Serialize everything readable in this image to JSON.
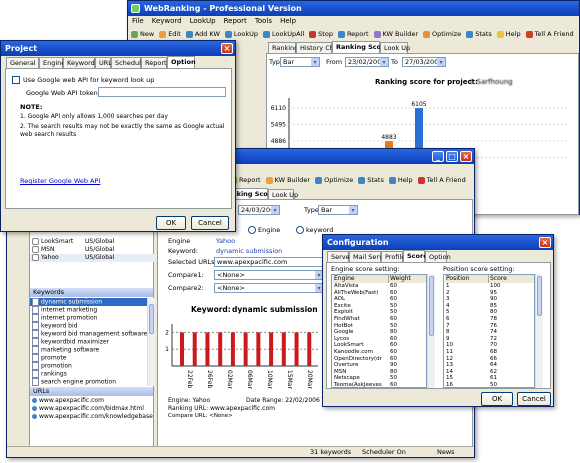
{
  "main_window": {
    "title": "WebRanking - Professional Version",
    "menu": [
      "File",
      "Keyword",
      "LookUp",
      "Report",
      "Tools",
      "Help"
    ],
    "toolbar": [
      "New",
      "Edit",
      "Add KW",
      "LookUp",
      "LookUpAll",
      "Stop",
      "Report",
      "KW Builder",
      "Optimize",
      "Stats",
      "Help",
      "Tell A Friend"
    ],
    "tabs": [
      "Ranking",
      "History Chart",
      "Ranking Score",
      "Look Up"
    ],
    "type_label": "Type",
    "type_value": "Bar",
    "from_label": "From",
    "from_value": "23/02/2006",
    "to_label": "To",
    "to_value": "27/03/2006",
    "chart_title": "Ranking score for project:",
    "chart_project": "I. Sarfhoung",
    "y_ticks": [
      "6110",
      "5495",
      "4886",
      "4277"
    ],
    "bar_labels": [
      "4883",
      "6105"
    ]
  },
  "project_dialog": {
    "title": "Project",
    "tabs": [
      "General",
      "Engines",
      "Keyword",
      "URL",
      "Scheduler",
      "Report",
      "Option"
    ],
    "checkbox_label": "Use Google web API for keyword look up",
    "token_label": "Google Web API token:",
    "token_value": "",
    "note_title": "NOTE:",
    "note_1": "1. Google API only allows 1,000 searches per day",
    "note_2": "2. The search results may not be exactly the same as Google actual web search results",
    "link": "Register Google Web API",
    "ok": "OK",
    "cancel": "Cancel"
  },
  "second_window": {
    "toolbar": [
      "Report",
      "KW Builder",
      "Optimize",
      "Stats",
      "Help",
      "Tell A Friend"
    ],
    "tabs": [
      "nking Score",
      "Look Up"
    ],
    "date_value": "24/03/2006",
    "type_label": "Type",
    "type_value": "Bar",
    "radio_engine": "Engine",
    "radio_keyword": "keyword",
    "engine_label": "Engine",
    "engine_value": "Yahoo",
    "keyword_label": "Keyword:",
    "keyword_value": "dynamic submission",
    "selected_urls_label": "Selected URLs",
    "selected_urls_value": "www.apexpacific.com",
    "compare1_label": "Compare1:",
    "compare1_value": "<None>",
    "compare2_label": "Compare2:",
    "compare2_value": "<None>",
    "chart_heading_label": "Keyword:",
    "chart_heading_value": "dynamic submission",
    "footer_engine": "Engine: Yahoo",
    "footer_date": "Date Range: 22/02/2006 To 24/03/2006",
    "footer_url": "Ranking URL: www.apexpacific.com",
    "footer_compare": "Compare URL: <None>"
  },
  "engines_list": [
    {
      "name": "LookSmart",
      "region": "US/Global"
    },
    {
      "name": "MSN",
      "region": "US/Global"
    },
    {
      "name": "Yahoo",
      "region": "US/Global"
    }
  ],
  "keywords_header": "Keywords",
  "keywords": [
    "dynamic submission",
    "internet marketing",
    "internet promotion",
    "keyword bid",
    "keyword bid management software",
    "keywordbid maximizer",
    "marketing software",
    "promote",
    "promotion",
    "rankings",
    "search engine promotion"
  ],
  "urls_header": "URLs",
  "urls": [
    "www.apexpacific.com",
    "www.apexpacific.com/bidmax.html",
    "www.apexpacific.com/knowledgebase"
  ],
  "status_bar": {
    "keywords": "31 keywords",
    "scheduler": "Scheduler On",
    "news": "News"
  },
  "config_dialog": {
    "title": "Configuration",
    "tabs": [
      "Server",
      "Mail Server",
      "Profile",
      "Score",
      "Option"
    ],
    "engine_score_label": "Engine score setting:",
    "position_score_label": "Position score setting:",
    "engine_headers": [
      "Engine",
      "Weight"
    ],
    "position_headers": [
      "Position",
      "Score"
    ],
    "engine_rows": [
      [
        "AltaVista",
        "60"
      ],
      [
        "AllTheWeb(Fast)",
        "60"
      ],
      [
        "AOL",
        "60"
      ],
      [
        "Excite",
        "50"
      ],
      [
        "Exploit",
        "50"
      ],
      [
        "FindWhat",
        "60"
      ],
      [
        "HotBot",
        "50"
      ],
      [
        "Google",
        "80"
      ],
      [
        "Lycos",
        "60"
      ],
      [
        "LookSmart",
        "60"
      ],
      [
        "Kanoodle.com",
        "60"
      ],
      [
        "OpenDirectory(dr",
        "60"
      ],
      [
        "Overture",
        "90"
      ],
      [
        "MSN",
        "80"
      ],
      [
        "Netscape",
        "50"
      ],
      [
        "Teoma(AskJeeves",
        "60"
      ]
    ],
    "position_rows": [
      [
        "1",
        "100"
      ],
      [
        "2",
        "95"
      ],
      [
        "3",
        "90"
      ],
      [
        "4",
        "85"
      ],
      [
        "5",
        "80"
      ],
      [
        "6",
        "78"
      ],
      [
        "7",
        "76"
      ],
      [
        "8",
        "74"
      ],
      [
        "9",
        "72"
      ],
      [
        "10",
        "70"
      ],
      [
        "11",
        "68"
      ],
      [
        "12",
        "66"
      ],
      [
        "13",
        "64"
      ],
      [
        "14",
        "62"
      ],
      [
        "15",
        "61"
      ],
      [
        "16",
        "50"
      ]
    ],
    "ok": "OK",
    "cancel": "Cancel"
  },
  "chart_data": [
    {
      "type": "bar",
      "title": "Ranking score for project:",
      "series": [
        {
          "values": [
            4883,
            6105
          ]
        }
      ],
      "y_ticks": [
        6110,
        5495,
        4886,
        4277
      ]
    },
    {
      "type": "bar",
      "title": "Keyword: dynamic submission",
      "categories": [
        "22Feb",
        "26Feb",
        "02Mar",
        "06Mar",
        "10Mar",
        "15Mar",
        "20Mar"
      ],
      "values": [
        2,
        2,
        2,
        2,
        2,
        2,
        2,
        2,
        2,
        2,
        2
      ],
      "y_ticks": [
        1,
        2
      ],
      "ylim": [
        0,
        2.5
      ]
    }
  ]
}
